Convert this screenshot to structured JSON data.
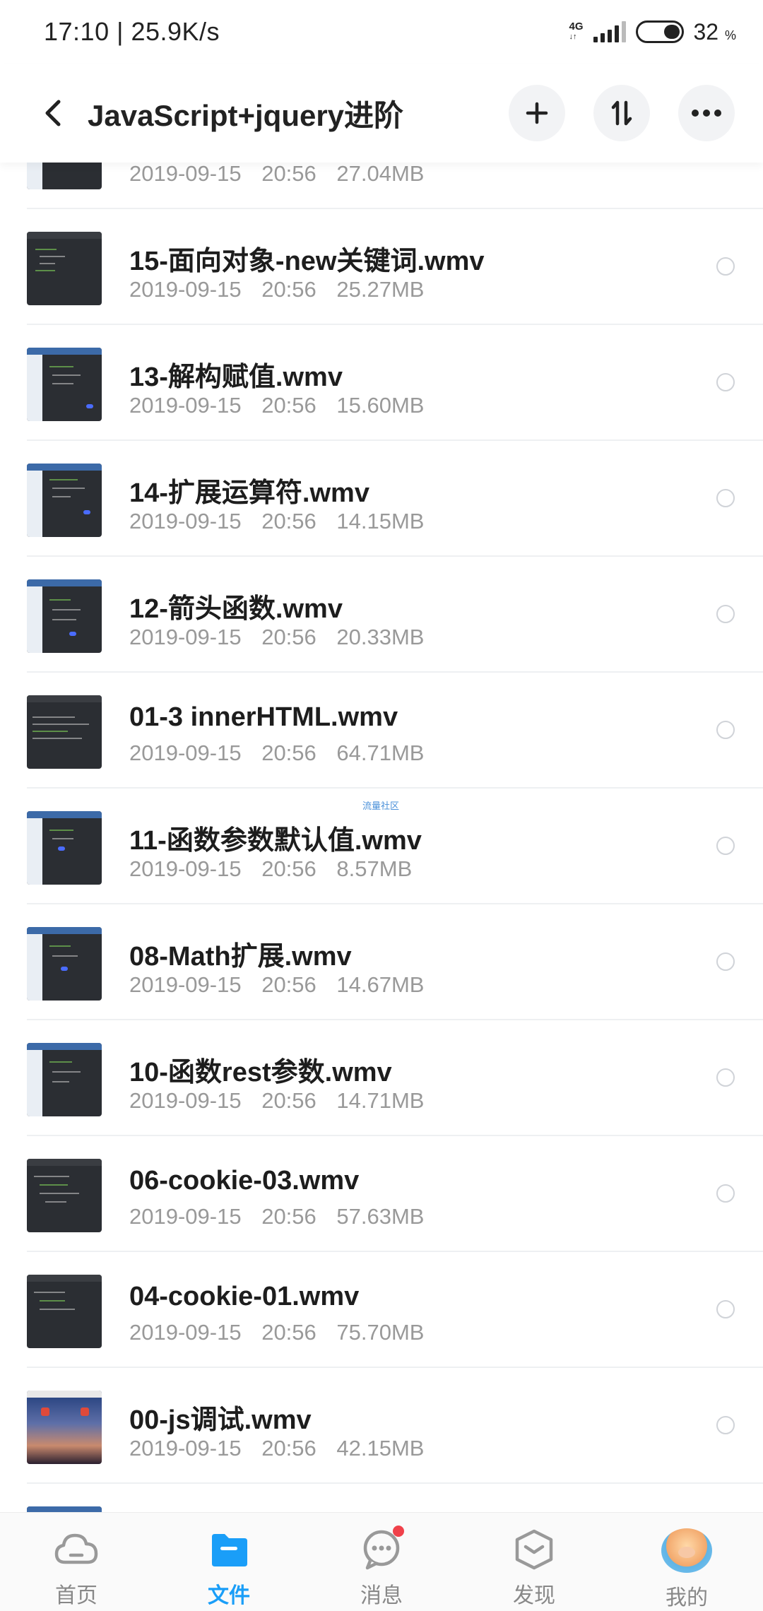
{
  "status_bar": {
    "time": "17:10 | 25.9K/s",
    "network_type": "4G",
    "battery_percent": "32",
    "battery_unit": "%"
  },
  "header": {
    "title": "JavaScript+jquery进阶",
    "back_icon": "chevron-left-icon",
    "add_icon": "plus-icon",
    "sort_icon": "sort-icon",
    "more_icon": "more-icon"
  },
  "files": [
    {
      "name": "",
      "date": "2019-09-15",
      "time": "20:56",
      "size": "27.04MB",
      "thumb": "ide-light"
    },
    {
      "name": "15-面向对象-new关键词.wmv",
      "date": "2019-09-15",
      "time": "20:56",
      "size": "25.27MB",
      "thumb": "dark"
    },
    {
      "name": "13-解构赋值.wmv",
      "date": "2019-09-15",
      "time": "20:56",
      "size": "15.60MB",
      "thumb": "ide-light"
    },
    {
      "name": "14-扩展运算符.wmv",
      "date": "2019-09-15",
      "time": "20:56",
      "size": "14.15MB",
      "thumb": "ide-light"
    },
    {
      "name": "12-箭头函数.wmv",
      "date": "2019-09-15",
      "time": "20:56",
      "size": "20.33MB",
      "thumb": "ide-light"
    },
    {
      "name": "01-3 innerHTML.wmv",
      "date": "2019-09-15",
      "time": "20:56",
      "size": "64.71MB",
      "thumb": "dark"
    },
    {
      "name": "11-函数参数默认值.wmv",
      "date": "2019-09-15",
      "time": "20:56",
      "size": "8.57MB",
      "thumb": "ide-light"
    },
    {
      "name": "08-Math扩展.wmv",
      "date": "2019-09-15",
      "time": "20:56",
      "size": "14.67MB",
      "thumb": "ide-light"
    },
    {
      "name": "10-函数rest参数.wmv",
      "date": "2019-09-15",
      "time": "20:56",
      "size": "14.71MB",
      "thumb": "ide-light"
    },
    {
      "name": "06-cookie-03.wmv",
      "date": "2019-09-15",
      "time": "20:56",
      "size": "57.63MB",
      "thumb": "dark"
    },
    {
      "name": "04-cookie-01.wmv",
      "date": "2019-09-15",
      "time": "20:56",
      "size": "75.70MB",
      "thumb": "dark"
    },
    {
      "name": "00-js调试.wmv",
      "date": "2019-09-15",
      "time": "20:56",
      "size": "42.15MB",
      "thumb": "photo"
    }
  ],
  "watermark": "流量社区",
  "bottom_nav": {
    "home": "首页",
    "files": "文件",
    "messages": "消息",
    "discover": "发现",
    "me": "我的"
  },
  "colors": {
    "accent": "#1a9ef8",
    "badge": "#f0414a",
    "meta_text": "#999999"
  }
}
